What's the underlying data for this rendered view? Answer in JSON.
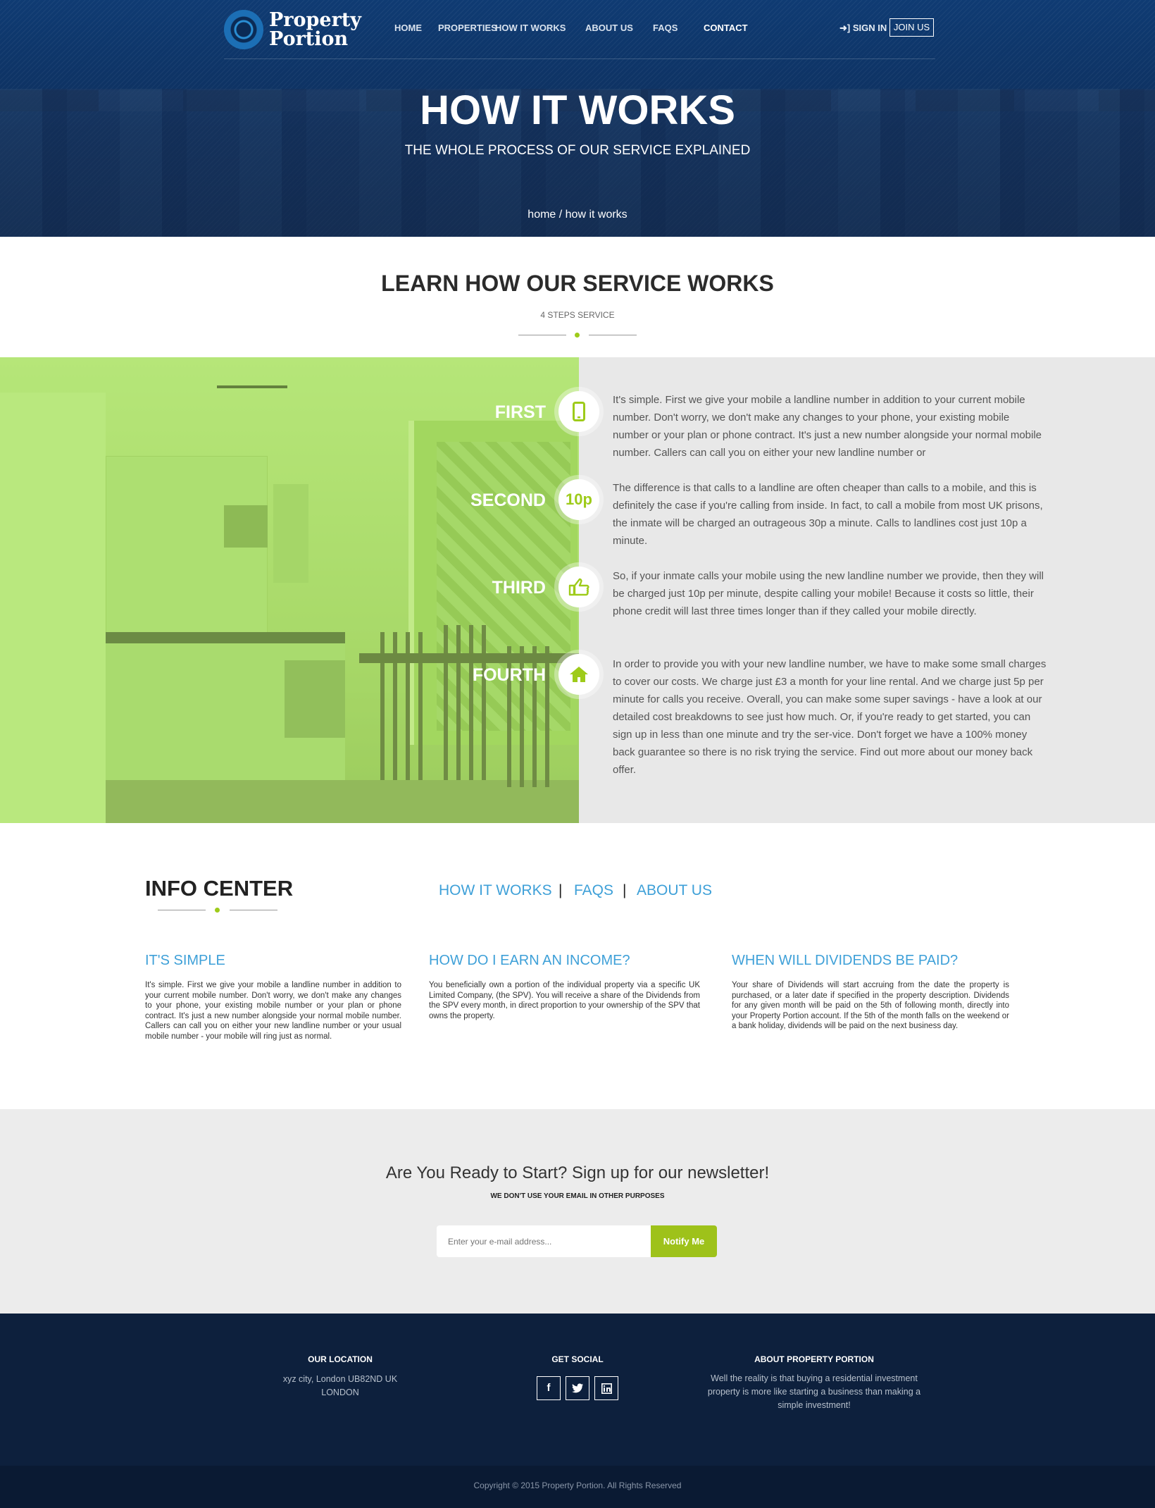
{
  "brand": {
    "line1": "Property",
    "line2": "Portion"
  },
  "nav": {
    "items": [
      "HOME",
      "PROPERTIES",
      "HOW IT WORKS",
      "ABOUT US",
      "FAQS",
      "CONTACT"
    ],
    "sign_in": "SIGN IN",
    "join": "JOIN US"
  },
  "hero": {
    "title": "HOW IT WORKS",
    "subtitle": "THE WHOLE PROCESS OF OUR SERVICE EXPLAINED",
    "breadcrumb": "home / how it works"
  },
  "learn": {
    "title": "LEARN HOW OUR SERVICE WORKS",
    "subtitle": "4 STEPS SERVICE"
  },
  "steps": [
    {
      "label": "FIRST",
      "icon": "mobile-phone-icon",
      "text": "It's simple. First we give your mobile a landline number in addition to your current mobile number. Don't worry, we don't make any changes to your phone, your existing mobile number or your plan or phone contract. It's just a new number alongside your normal mobile number. Callers can call you on either your new landline number or"
    },
    {
      "label": "SECOND",
      "icon": "10p",
      "text": "The difference is that calls to a landline are often cheaper than calls to a mobile, and this is definitely the case if you're calling from inside. In fact, to call a mobile from most UK prisons, the inmate will be charged an outrageous 30p a minute. Calls to landlines cost just 10p a minute."
    },
    {
      "label": "THIRD",
      "icon": "hand-pointer-icon",
      "text": "So, if your inmate calls your mobile using the new landline number we provide, then they will be charged just 10p per minute, despite calling your mobile! Because it costs so little, their phone credit will last three times longer than if they called your mobile directly."
    },
    {
      "label": "FOURTH",
      "icon": "home-icon",
      "text": "In order to provide you with your new landline number, we have to make some small charges to cover our costs. We charge just £3 a month for your line rental. And we charge just 5p per minute for calls you receive. Overall, you can make some super savings - have a look at our detailed cost breakdowns to see just how much. Or, if you're ready to get started, you can sign up in less than one minute and try the ser-vice. Don't forget we have a 100% money back guarantee so there is no risk trying the service. Find out more about our money back offer."
    }
  ],
  "info_center": {
    "title": "INFO CENTER",
    "tabs": [
      "HOW IT WORKS",
      "FAQS",
      "ABOUT US"
    ],
    "columns": [
      {
        "heading": "IT'S SIMPLE",
        "body": "It's simple. First we give your mobile a landline number in addition to your current mobile number. Don't worry, we don't make any changes to your phone, your existing mobile number or your plan or phone contract. It's just a new number alongside your normal mobile number. Callers can call you on either your new landline number or your usual mobile number - your mobile will ring just as normal."
      },
      {
        "heading": "HOW DO I EARN AN INCOME?",
        "body": "You beneficially own a portion of the individual property via a specific UK Limited Company, (the SPV). You will receive a share of the Dividends from the SPV every month, in direct proportion to your ownership of the SPV that owns the property."
      },
      {
        "heading": "WHEN WILL DIVIDENDS BE PAID?",
        "body": "Your share of Dividends will start accruing from the date the property is purchased, or a later date if specified in the property description. Dividends for any given month will be paid on the 5th of following month, directly into your Property Portion account. If the 5th of the month falls on the weekend or a bank holiday, dividends will be paid on the next business day."
      }
    ]
  },
  "newsletter": {
    "title": "Are You Ready to Start? Sign up for our newsletter!",
    "subtitle": "WE DON'T USE YOUR EMAIL IN OTHER PURPOSES",
    "placeholder": "Enter your e-mail address...",
    "button": "Notify Me"
  },
  "footer": {
    "location_heading": "OUR LOCATION",
    "location_line1": "xyz city, London UB82ND UK",
    "location_line2": "LONDON",
    "social_heading": "GET SOCIAL",
    "social_icons": [
      "facebook-icon",
      "twitter-icon",
      "linkedin-icon"
    ],
    "about_heading": "ABOUT PROPERTY PORTION",
    "about_text": "Well the reality is that buying a residential investment property is more like starting a business than making a simple investment!",
    "copyright": "Copyright © 2015 Property Portion. All Rights Reserved"
  },
  "colors": {
    "accent_green": "#9ecb1a",
    "link_blue": "#3ea0d8",
    "hero_navy": "#0f3b73",
    "footer_navy": "#0d203d"
  }
}
